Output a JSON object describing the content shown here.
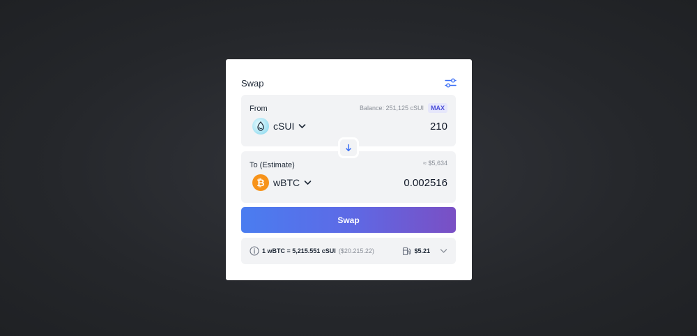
{
  "swap": {
    "title": "Swap",
    "settings_icon": "sliders-icon",
    "from": {
      "label": "From",
      "balance": "Balance: 251,125 cSUI",
      "max_label": "MAX",
      "token": "cSUI",
      "token_icon": "csui-token-icon",
      "amount": "210"
    },
    "to": {
      "label": "To (Estimate)",
      "usd_estimate": "≈ $5,634",
      "token": "wBTC",
      "token_icon": "wbtc-token-icon",
      "amount": "0.002516"
    },
    "swap_button_label": "Swap",
    "rate": {
      "text": "1 wBTC = 5,215.551 cSUI",
      "usd": "($20.215.22)",
      "gas_fee": "$5.21"
    },
    "colors": {
      "accent_blue": "#3b6ff5",
      "gradient_start": "#4a7df0",
      "gradient_end": "#7a4fc4",
      "btc_orange": "#f7931a",
      "max_badge_bg": "#e6e7fb",
      "max_badge_text": "#4b4fd8"
    }
  }
}
